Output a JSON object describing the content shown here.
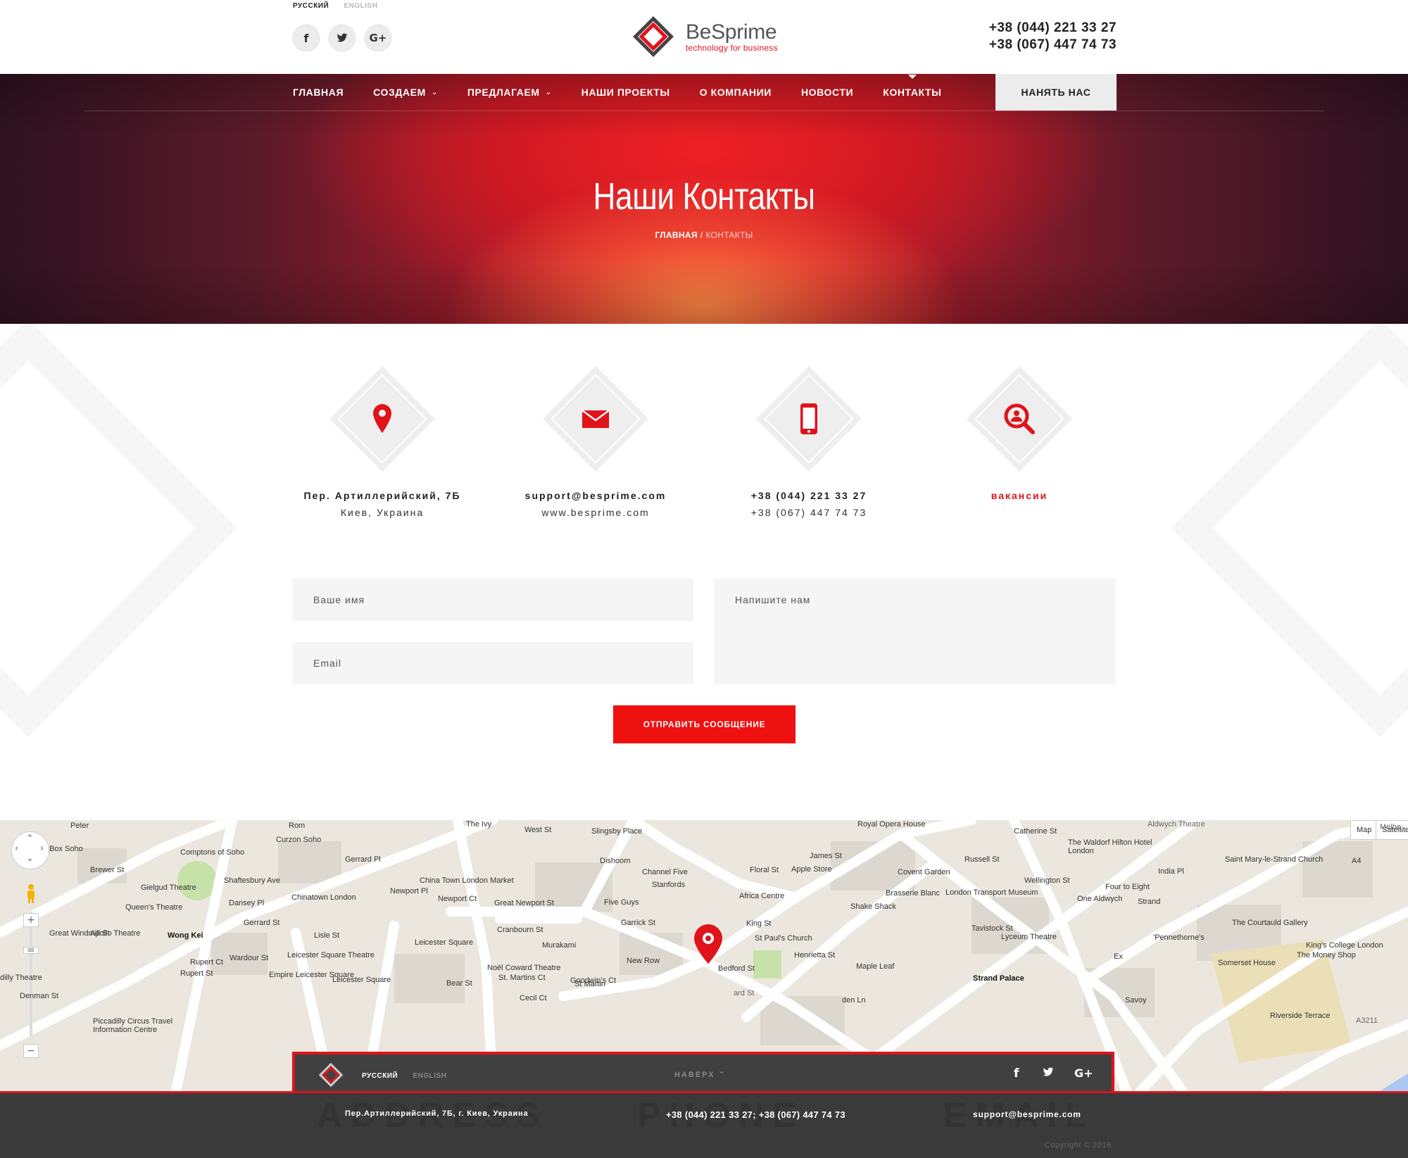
{
  "header": {
    "languages": {
      "active": "РУССКИЙ",
      "inactive": "ENGLISH"
    },
    "socials": [
      "facebook-icon",
      "twitter-icon",
      "google-plus-icon"
    ],
    "logo": {
      "name": "BeSprime",
      "tagline": "technology for business"
    },
    "phones": [
      "+38 (044) 221 33 27",
      "+38 (067) 447 74 73"
    ]
  },
  "nav": {
    "items": [
      {
        "label": "ГЛАВНАЯ",
        "dropdown": false
      },
      {
        "label": "СОЗДАЕМ",
        "dropdown": true
      },
      {
        "label": "ПРЕДЛАГАЕМ",
        "dropdown": true
      },
      {
        "label": "НАШИ ПРОЕКТЫ",
        "dropdown": false
      },
      {
        "label": "О КОМПАНИИ",
        "dropdown": false
      },
      {
        "label": "НОВОСТИ",
        "dropdown": false
      },
      {
        "label": "КОНТАКТЫ",
        "dropdown": false,
        "active": true
      }
    ],
    "hire_label": "НАНЯТЬ НАС"
  },
  "hero": {
    "title": "Наши Контакты",
    "breadcrumb_home": "ГЛАВНАЯ",
    "breadcrumb_sep": "/",
    "breadcrumb_current": "КОНТАКТЫ"
  },
  "contacts": [
    {
      "icon": "location-pin-icon",
      "line1": "Пер. Артиллерийский, 7Б",
      "line2": "Киев, Украина"
    },
    {
      "icon": "envelope-icon",
      "line1": "support@besprime.com",
      "line2": "www.besprime.com"
    },
    {
      "icon": "mobile-phone-icon",
      "line1": "+38 (044) 221 33 27",
      "line2": "+38 (067) 447 74 73"
    },
    {
      "icon": "vacancy-search-icon",
      "line1": "вакансии",
      "line2": ""
    }
  ],
  "form": {
    "name_placeholder": "Ваше имя",
    "email_placeholder": "Email",
    "message_placeholder": "Напишите нам",
    "submit_label": "ОТПРАВИТЬ СООБЩЕНИЕ"
  },
  "map": {
    "type_buttons": [
      "Map",
      "Satellite"
    ],
    "labels": [
      "Peter",
      "Rom",
      "The Ivy",
      "West St",
      "Slingsby Place",
      "Royal Opera House",
      "Catherine St",
      "Aldwych Theatre",
      "Melbo",
      "Box Soho",
      "Curzon Soho",
      "Gerrard Pl",
      "Comptons of Soho",
      "Brewer St",
      "China Town London Market",
      "Dishoom",
      "Channel Five",
      "Stanfords",
      "Floral St",
      "James St",
      "Apple Store",
      "Covent Garden",
      "Russell St",
      "Wellington St",
      "The Waldorf Hilton Hotel London",
      "India Pl",
      "Saint Mary-le-Strand Church",
      "A4",
      "Gielgud Theatre",
      "Shaftesbury Ave",
      "Chinatown London",
      "Newport Pl",
      "Newport Ct",
      "Great Newport St",
      "Five Guys",
      "Africa Centre",
      "Brasserie Blanc",
      "London Transport Museum",
      "Shake Shack",
      "Four to Eight",
      "One Aldwych",
      "Strand",
      "Queen's Theatre",
      "Dansey Pl",
      "Garrick St",
      "King St",
      "St Paul's Church",
      "Tavistock St",
      "Lyceum Theatre",
      "The Courtauld Gallery",
      "'Pennethorne's",
      "King's College London",
      "The Money Shop",
      "Apollo Theatre",
      "Great Windmill St",
      "Gerrard St",
      "Wong Kei",
      "Leicester Square",
      "Cranbourn St",
      "Murakami",
      "Lisle St",
      "Leicester Square Theatre",
      "Rupert Ct",
      "Wardour St",
      "Henrietta St",
      "Bedford St",
      "Noël Coward Theatre",
      "St. Martins Ct",
      "New Row",
      "Maple Leaf",
      "Somerset House",
      "dilly Theatre",
      "Empire Leicester Square",
      "Leicester Square",
      "Bear St",
      "Goodwin's Ct",
      "Strand Palace",
      "Denman St",
      "Rupert St",
      "Cecil Ct",
      "St Martin",
      "Piccadilly Circus Travel Information Centre",
      "Riverside Terrace",
      "A3211",
      "ard St",
      "den Ln",
      "Ex",
      "Savoy"
    ]
  },
  "footer": {
    "languages": {
      "active": "РУССКИЙ",
      "inactive": "ENGLISH"
    },
    "totop_label": "НАВЕРХ",
    "big_words": [
      "ADDRESS",
      "PHONE",
      "EMAIL"
    ],
    "address": "Пер.Артиллерийский, 7Б, г. Киев, Украина",
    "phones": "+38 (044) 221 33 27; +38 (067) 447 74 73",
    "email": "support@besprime.com",
    "copyright": "Copyright © 2016"
  },
  "colors": {
    "accent": "#e0131b",
    "button": "#ef1010",
    "footer": "#3a3a3a",
    "footer_bar": "#404040",
    "field_bg": "#f5f5f5"
  }
}
